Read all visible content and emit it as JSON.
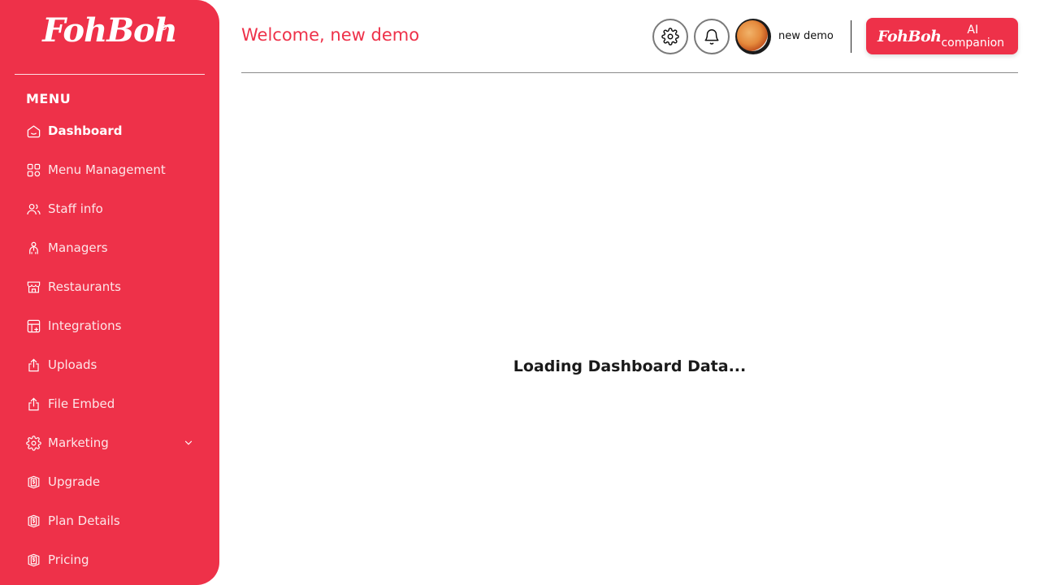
{
  "sidebar": {
    "logo": "FohBoh",
    "menu_heading": "MENU",
    "items": [
      {
        "label": "Dashboard",
        "icon": "home-icon",
        "active": true
      },
      {
        "label": "Menu Management",
        "icon": "grid-icon"
      },
      {
        "label": "Staff info",
        "icon": "users-icon"
      },
      {
        "label": "Managers",
        "icon": "manager-icon"
      },
      {
        "label": "Restaurants",
        "icon": "store-icon"
      },
      {
        "label": "Integrations",
        "icon": "table-plus-icon"
      },
      {
        "label": "Uploads",
        "icon": "upload-icon"
      },
      {
        "label": "File Embed",
        "icon": "upload-icon"
      },
      {
        "label": "Marketing",
        "icon": "gear-icon",
        "expandable": true
      },
      {
        "label": "Upgrade",
        "icon": "dollar-shield-icon"
      },
      {
        "label": "Plan Details",
        "icon": "dollar-shield-icon"
      },
      {
        "label": "Pricing",
        "icon": "dollar-shield-icon"
      }
    ]
  },
  "header": {
    "welcome": "Welcome, new demo",
    "user_name": "new demo",
    "ai_logo": "FohBoh",
    "ai_label_line1": "AI",
    "ai_label_line2": "companion"
  },
  "main": {
    "loading_text": "Loading Dashboard Data..."
  },
  "colors": {
    "brand": "#ee3149",
    "text": "#1a1a1a"
  }
}
